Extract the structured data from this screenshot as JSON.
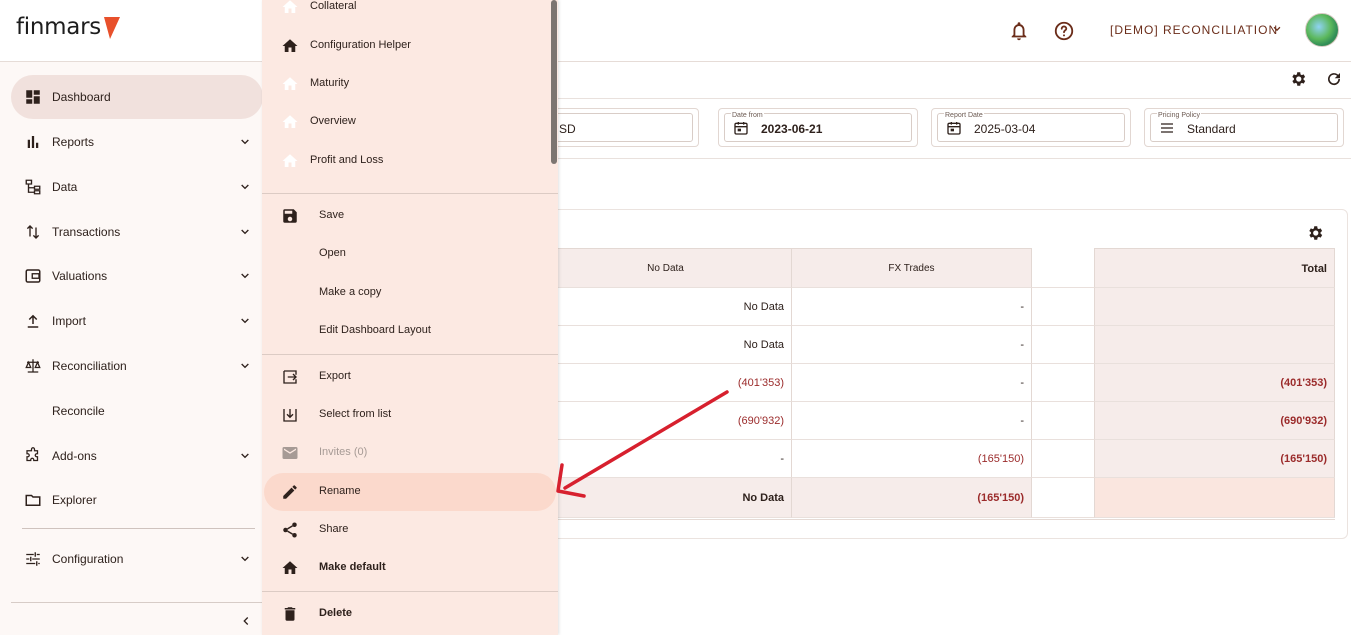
{
  "header": {
    "logo": "finmars",
    "workspace": "[DEMO] RECONCILIATION",
    "icons": [
      "bell-icon",
      "help-icon"
    ]
  },
  "sidebar": {
    "items": [
      {
        "label": "Dashboard",
        "icon": "dashboard-icon",
        "active": true
      },
      {
        "label": "Reports",
        "icon": "bar-chart-icon",
        "expandable": true
      },
      {
        "label": "Data",
        "icon": "data-tree-icon",
        "expandable": true
      },
      {
        "label": "Transactions",
        "icon": "swap-vertical-icon",
        "expandable": true
      },
      {
        "label": "Valuations",
        "icon": "wallet-icon",
        "expandable": true
      },
      {
        "label": "Import",
        "icon": "upload-icon",
        "expandable": true
      },
      {
        "label": "Reconciliation",
        "icon": "balance-scale-icon",
        "expandable": true
      },
      {
        "label": "Reconcile",
        "sub": true
      },
      {
        "label": "Add-ons",
        "icon": "puzzle-icon",
        "expandable": true
      },
      {
        "label": "Explorer",
        "icon": "folder-icon"
      },
      {
        "label": "Configuration",
        "icon": "tune-icon",
        "expandable": true
      }
    ]
  },
  "filters": {
    "currency_partial": "SD",
    "date_from": {
      "label": "Date from",
      "value": "2023-06-21"
    },
    "report_date": {
      "label": "Report Date",
      "value": "2025-03-04"
    },
    "pricing_policy": {
      "label": "Pricing Policy",
      "value": "Standard"
    }
  },
  "grid": {
    "headers": [
      "No Data",
      "FX Trades",
      "",
      "Total"
    ],
    "rows": [
      [
        "No Data",
        "-",
        "",
        ""
      ],
      [
        "No Data",
        "-",
        "",
        ""
      ],
      [
        "(401'353)",
        "-",
        "",
        "(401'353)"
      ],
      [
        "(690'932)",
        "-",
        "",
        "(690'932)"
      ],
      [
        "-",
        "(165'150)",
        "",
        "(165'150)"
      ],
      [
        "No Data",
        "(165'150)",
        "",
        ""
      ]
    ]
  },
  "menu": {
    "layouts": [
      {
        "label": "Collateral",
        "icon": "home-icon",
        "muted": true
      },
      {
        "label": "Configuration Helper",
        "icon": "home-icon"
      },
      {
        "label": "Maturity",
        "icon": "home-icon",
        "muted": true
      },
      {
        "label": "Overview",
        "icon": "home-icon",
        "muted": true
      },
      {
        "label": "Profit and Loss",
        "icon": "home-icon",
        "muted": true
      }
    ],
    "actions_1": [
      {
        "label": "Save",
        "icon": "save-icon"
      },
      {
        "label": "Open",
        "icon": ""
      },
      {
        "label": "Make a copy",
        "icon": ""
      },
      {
        "label": "Edit Dashboard Layout",
        "icon": ""
      }
    ],
    "actions_2": [
      {
        "label": "Export",
        "icon": "export-icon"
      },
      {
        "label": "Select from list",
        "icon": "download-box-icon"
      },
      {
        "label": "Invites (0)",
        "icon": "mail-icon",
        "disabled": true
      },
      {
        "label": "Rename",
        "icon": "pencil-icon",
        "highlighted": true
      },
      {
        "label": "Share",
        "icon": "share-icon"
      },
      {
        "label": "Make default",
        "icon": "home-icon"
      }
    ],
    "actions_3": [
      {
        "label": "Delete",
        "icon": "trash-icon"
      }
    ]
  },
  "colors": {
    "accent": "#e8502b",
    "menu_bg": "#fce9e2",
    "highlight": "#fbd9cc",
    "negative": "#9b2b2b",
    "annotation_arrow": "#d7202e"
  }
}
